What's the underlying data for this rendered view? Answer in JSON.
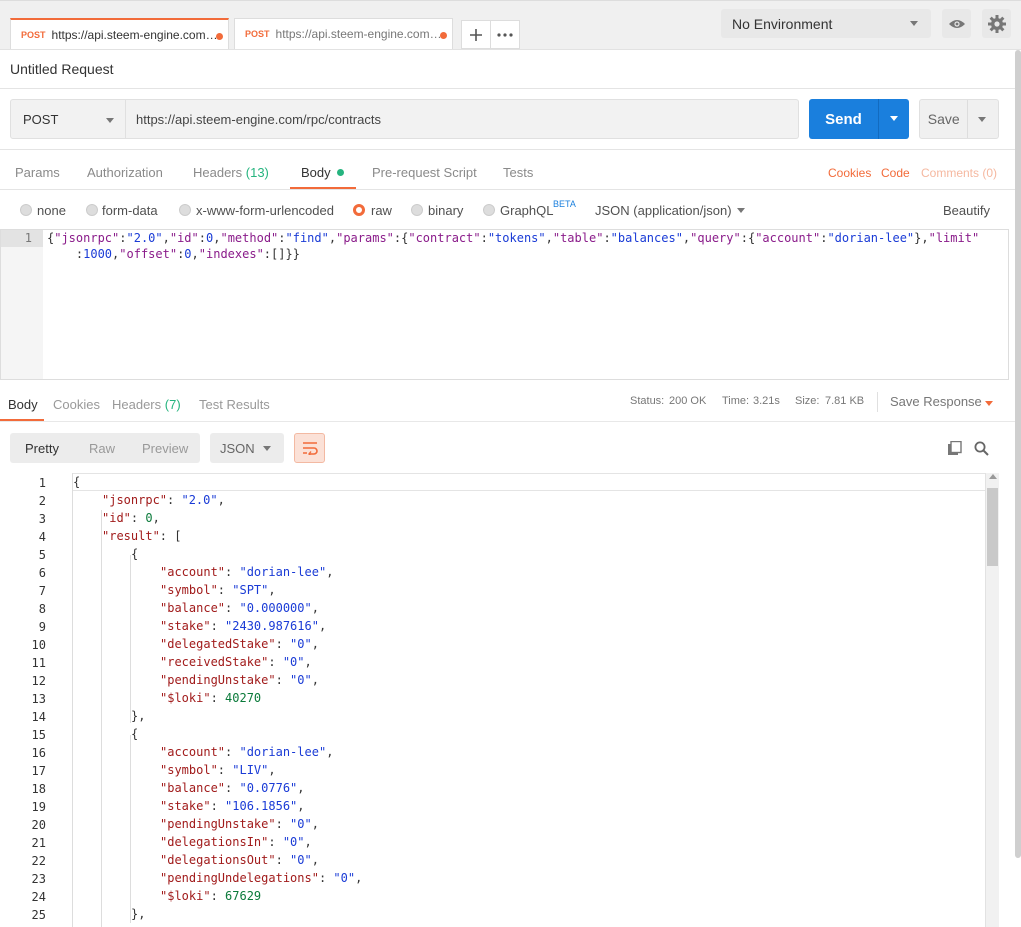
{
  "tabs": [
    {
      "method": "POST",
      "url": "https://api.steem-engine.com/rpc/contracts",
      "active": true
    },
    {
      "method": "POST",
      "url": "https://api.steem-engine.com/rpc/contracts",
      "active": false
    }
  ],
  "environment": {
    "selected": "No Environment"
  },
  "request": {
    "title": "Untitled Request",
    "method": "POST",
    "url": "https://api.steem-engine.com/rpc/contracts",
    "send_label": "Send",
    "save_label": "Save"
  },
  "request_tabs": {
    "params": "Params",
    "authorization": "Authorization",
    "headers": "Headers",
    "headers_count": "(13)",
    "body": "Body",
    "prerequest": "Pre-request Script",
    "tests": "Tests",
    "cookies": "Cookies",
    "code": "Code",
    "comments": "Comments (0)"
  },
  "body_types": {
    "none": "none",
    "form_data": "form-data",
    "urlencoded": "x-www-form-urlencoded",
    "raw": "raw",
    "binary": "binary",
    "graphql": "GraphQL",
    "beta": "BETA",
    "content_type": "JSON (application/json)",
    "beautify": "Beautify"
  },
  "editor": {
    "line_number": "1",
    "line1_segments": [
      {
        "t": "{",
        "c": "p"
      },
      {
        "t": "\"jsonrpc\"",
        "c": "k"
      },
      {
        "t": ":",
        "c": "p"
      },
      {
        "t": "\"2.0\"",
        "c": "s"
      },
      {
        "t": ",",
        "c": "p"
      },
      {
        "t": "\"id\"",
        "c": "k"
      },
      {
        "t": ":",
        "c": "p"
      },
      {
        "t": "0",
        "c": "n"
      },
      {
        "t": ",",
        "c": "p"
      },
      {
        "t": "\"method\"",
        "c": "k"
      },
      {
        "t": ":",
        "c": "p"
      },
      {
        "t": "\"find\"",
        "c": "s"
      },
      {
        "t": ",",
        "c": "p"
      },
      {
        "t": "\"params\"",
        "c": "k"
      },
      {
        "t": ":{",
        "c": "p"
      },
      {
        "t": "\"contract\"",
        "c": "k"
      },
      {
        "t": ":",
        "c": "p"
      },
      {
        "t": "\"tokens\"",
        "c": "s"
      },
      {
        "t": ",",
        "c": "p"
      },
      {
        "t": "\"table\"",
        "c": "k"
      },
      {
        "t": ":",
        "c": "p"
      },
      {
        "t": "\"balances\"",
        "c": "s"
      },
      {
        "t": ",",
        "c": "p"
      },
      {
        "t": "\"query\"",
        "c": "k"
      },
      {
        "t": ":{",
        "c": "p"
      },
      {
        "t": "\"account\"",
        "c": "k"
      },
      {
        "t": ":",
        "c": "p"
      },
      {
        "t": "\"dorian-lee\"",
        "c": "s"
      },
      {
        "t": "},",
        "c": "p"
      },
      {
        "t": "\"limit\"",
        "c": "k"
      }
    ],
    "line2_segments": [
      {
        "t": "    :",
        "c": "p"
      },
      {
        "t": "1000",
        "c": "n"
      },
      {
        "t": ",",
        "c": "p"
      },
      {
        "t": "\"offset\"",
        "c": "k"
      },
      {
        "t": ":",
        "c": "p"
      },
      {
        "t": "0",
        "c": "n"
      },
      {
        "t": ",",
        "c": "p"
      },
      {
        "t": "\"indexes\"",
        "c": "k"
      },
      {
        "t": ":[]}}",
        "c": "p"
      }
    ]
  },
  "response_tabs": {
    "body": "Body",
    "cookies": "Cookies",
    "headers": "Headers",
    "headers_count": "(7)",
    "test_results": "Test Results"
  },
  "response_meta": {
    "status_label": "Status:",
    "status_value": "200 OK",
    "time_label": "Time:",
    "time_value": "3.21s",
    "size_label": "Size:",
    "size_value": "7.81 KB",
    "save_response": "Save Response"
  },
  "response_view": {
    "pretty": "Pretty",
    "raw": "Raw",
    "preview": "Preview",
    "format": "JSON"
  },
  "response_lines": [
    {
      "n": "1",
      "indent": 0,
      "parts": [
        {
          "t": "{",
          "c": "p"
        }
      ]
    },
    {
      "n": "2",
      "indent": 1,
      "parts": [
        {
          "t": "\"jsonrpc\"",
          "c": "key"
        },
        {
          "t": ": ",
          "c": "p"
        },
        {
          "t": "\"2.0\"",
          "c": "str"
        },
        {
          "t": ",",
          "c": "p"
        }
      ]
    },
    {
      "n": "3",
      "indent": 1,
      "parts": [
        {
          "t": "\"id\"",
          "c": "key"
        },
        {
          "t": ": ",
          "c": "p"
        },
        {
          "t": "0",
          "c": "num"
        },
        {
          "t": ",",
          "c": "p"
        }
      ]
    },
    {
      "n": "4",
      "indent": 1,
      "parts": [
        {
          "t": "\"result\"",
          "c": "key"
        },
        {
          "t": ": [",
          "c": "p"
        }
      ]
    },
    {
      "n": "5",
      "indent": 2,
      "parts": [
        {
          "t": "{",
          "c": "p"
        }
      ]
    },
    {
      "n": "6",
      "indent": 3,
      "parts": [
        {
          "t": "\"account\"",
          "c": "key"
        },
        {
          "t": ": ",
          "c": "p"
        },
        {
          "t": "\"dorian-lee\"",
          "c": "str"
        },
        {
          "t": ",",
          "c": "p"
        }
      ]
    },
    {
      "n": "7",
      "indent": 3,
      "parts": [
        {
          "t": "\"symbol\"",
          "c": "key"
        },
        {
          "t": ": ",
          "c": "p"
        },
        {
          "t": "\"SPT\"",
          "c": "str"
        },
        {
          "t": ",",
          "c": "p"
        }
      ]
    },
    {
      "n": "8",
      "indent": 3,
      "parts": [
        {
          "t": "\"balance\"",
          "c": "key"
        },
        {
          "t": ": ",
          "c": "p"
        },
        {
          "t": "\"0.000000\"",
          "c": "str"
        },
        {
          "t": ",",
          "c": "p"
        }
      ]
    },
    {
      "n": "9",
      "indent": 3,
      "parts": [
        {
          "t": "\"stake\"",
          "c": "key"
        },
        {
          "t": ": ",
          "c": "p"
        },
        {
          "t": "\"2430.987616\"",
          "c": "str"
        },
        {
          "t": ",",
          "c": "p"
        }
      ]
    },
    {
      "n": "10",
      "indent": 3,
      "parts": [
        {
          "t": "\"delegatedStake\"",
          "c": "key"
        },
        {
          "t": ": ",
          "c": "p"
        },
        {
          "t": "\"0\"",
          "c": "str"
        },
        {
          "t": ",",
          "c": "p"
        }
      ]
    },
    {
      "n": "11",
      "indent": 3,
      "parts": [
        {
          "t": "\"receivedStake\"",
          "c": "key"
        },
        {
          "t": ": ",
          "c": "p"
        },
        {
          "t": "\"0\"",
          "c": "str"
        },
        {
          "t": ",",
          "c": "p"
        }
      ]
    },
    {
      "n": "12",
      "indent": 3,
      "parts": [
        {
          "t": "\"pendingUnstake\"",
          "c": "key"
        },
        {
          "t": ": ",
          "c": "p"
        },
        {
          "t": "\"0\"",
          "c": "str"
        },
        {
          "t": ",",
          "c": "p"
        }
      ]
    },
    {
      "n": "13",
      "indent": 3,
      "parts": [
        {
          "t": "\"$loki\"",
          "c": "key"
        },
        {
          "t": ": ",
          "c": "p"
        },
        {
          "t": "40270",
          "c": "num"
        }
      ]
    },
    {
      "n": "14",
      "indent": 2,
      "parts": [
        {
          "t": "},",
          "c": "p"
        }
      ]
    },
    {
      "n": "15",
      "indent": 2,
      "parts": [
        {
          "t": "{",
          "c": "p"
        }
      ]
    },
    {
      "n": "16",
      "indent": 3,
      "parts": [
        {
          "t": "\"account\"",
          "c": "key"
        },
        {
          "t": ": ",
          "c": "p"
        },
        {
          "t": "\"dorian-lee\"",
          "c": "str"
        },
        {
          "t": ",",
          "c": "p"
        }
      ]
    },
    {
      "n": "17",
      "indent": 3,
      "parts": [
        {
          "t": "\"symbol\"",
          "c": "key"
        },
        {
          "t": ": ",
          "c": "p"
        },
        {
          "t": "\"LIV\"",
          "c": "str"
        },
        {
          "t": ",",
          "c": "p"
        }
      ]
    },
    {
      "n": "18",
      "indent": 3,
      "parts": [
        {
          "t": "\"balance\"",
          "c": "key"
        },
        {
          "t": ": ",
          "c": "p"
        },
        {
          "t": "\"0.0776\"",
          "c": "str"
        },
        {
          "t": ",",
          "c": "p"
        }
      ]
    },
    {
      "n": "19",
      "indent": 3,
      "parts": [
        {
          "t": "\"stake\"",
          "c": "key"
        },
        {
          "t": ": ",
          "c": "p"
        },
        {
          "t": "\"106.1856\"",
          "c": "str"
        },
        {
          "t": ",",
          "c": "p"
        }
      ]
    },
    {
      "n": "20",
      "indent": 3,
      "parts": [
        {
          "t": "\"pendingUnstake\"",
          "c": "key"
        },
        {
          "t": ": ",
          "c": "p"
        },
        {
          "t": "\"0\"",
          "c": "str"
        },
        {
          "t": ",",
          "c": "p"
        }
      ]
    },
    {
      "n": "21",
      "indent": 3,
      "parts": [
        {
          "t": "\"delegationsIn\"",
          "c": "key"
        },
        {
          "t": ": ",
          "c": "p"
        },
        {
          "t": "\"0\"",
          "c": "str"
        },
        {
          "t": ",",
          "c": "p"
        }
      ]
    },
    {
      "n": "22",
      "indent": 3,
      "parts": [
        {
          "t": "\"delegationsOut\"",
          "c": "key"
        },
        {
          "t": ": ",
          "c": "p"
        },
        {
          "t": "\"0\"",
          "c": "str"
        },
        {
          "t": ",",
          "c": "p"
        }
      ]
    },
    {
      "n": "23",
      "indent": 3,
      "parts": [
        {
          "t": "\"pendingUndelegations\"",
          "c": "key"
        },
        {
          "t": ": ",
          "c": "p"
        },
        {
          "t": "\"0\"",
          "c": "str"
        },
        {
          "t": ",",
          "c": "p"
        }
      ]
    },
    {
      "n": "24",
      "indent": 3,
      "parts": [
        {
          "t": "\"$loki\"",
          "c": "key"
        },
        {
          "t": ": ",
          "c": "p"
        },
        {
          "t": "67629",
          "c": "num"
        }
      ]
    },
    {
      "n": "25",
      "indent": 2,
      "parts": [
        {
          "t": "},",
          "c": "p"
        }
      ]
    }
  ],
  "colors": {
    "accent": "#f26b3a",
    "send": "#1a7fdd",
    "green": "#26b47f"
  },
  "icons": [
    "plus-icon",
    "more-icon",
    "eye-icon",
    "gear-icon",
    "wrap-icon",
    "copy-icon",
    "search-icon",
    "caret-down-icon"
  ]
}
